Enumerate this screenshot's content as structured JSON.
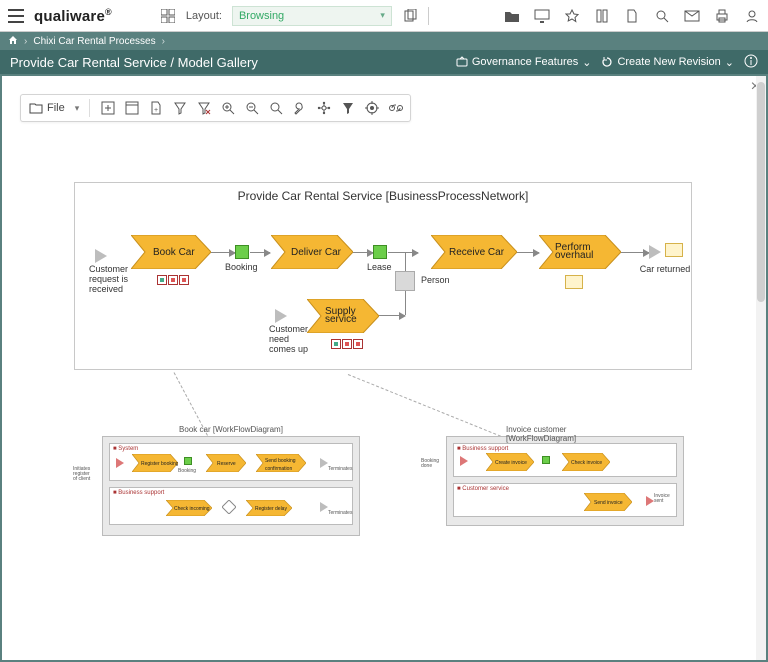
{
  "brand": "qualiware",
  "topbar": {
    "layout_label": "Layout:",
    "layout_value": "Browsing"
  },
  "breadcrumb": {
    "item1": "Chixi Car Rental Processes"
  },
  "pagehead": {
    "title": "Provide Car Rental Service / Model Gallery",
    "gov_label": "Governance Features",
    "rev_label": "Create New Revision"
  },
  "toolbar": {
    "file_label": "File"
  },
  "diagram": {
    "title": "Provide Car Rental Service [BusinessProcessNetwork]",
    "start1": "Customer\nrequest is\nreceived",
    "start2": "Customer\nneed\ncomes up",
    "book": "Book Car",
    "booking": "Booking",
    "deliver": "Deliver Car",
    "lease": "Lease",
    "supply": "Supply\nservice",
    "person": "Person",
    "receive": "Receive Car",
    "overhaul": "Perform\noverhaul",
    "end": "Car returned"
  },
  "sub1": {
    "title": "Book car [WorkFlowDiagram]",
    "lane1": "System",
    "lane2": "Business support",
    "a1": "Register booking",
    "a2": "Reserve",
    "a3": "Send booking\nconfirmation",
    "b1": "Check incoming",
    "b2": "Register delay",
    "lbl_booking": "Booking",
    "lbl_term": "Terminates",
    "lbl_init": "Initiates\nregister\nof client"
  },
  "sub2": {
    "title": "Invoice customer [WorkFlowDiagram]",
    "lane1": "Business support",
    "lane2": "Customer service",
    "a1": "Create invoice",
    "a2": "Check invoice",
    "a3": "Send invoice",
    "lbl_booking": "Booking\ndone",
    "lbl_inv": "Invoice\nsent"
  }
}
